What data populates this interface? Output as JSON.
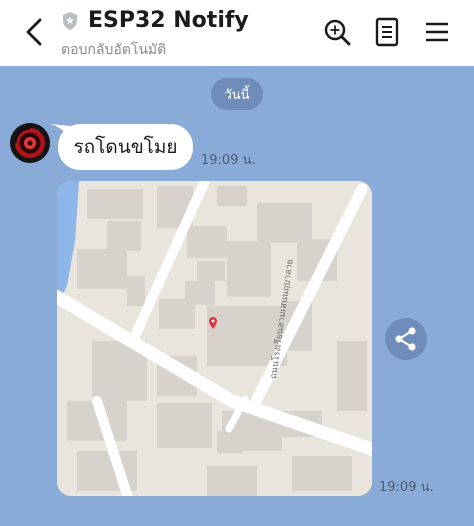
{
  "header": {
    "title": "ESP32 Notify",
    "subtitle": "ตอบกลับอัตโนมัติ",
    "icons": [
      "back-arrow-icon",
      "shield-star-icon",
      "search-icon",
      "notes-icon",
      "menu-icon"
    ]
  },
  "chat": {
    "date_label": "วันนี้",
    "messages": [
      {
        "type": "text",
        "text": "รถโดนขโมย",
        "time": "19:09 น."
      },
      {
        "type": "map",
        "street_label": "ถนนโรงเรียนสามเสนนฤบาลาย",
        "time": "19:09 น."
      }
    ]
  },
  "colors": {
    "chat_background": "#8aaad8",
    "date_pill": "#6f8cba",
    "share_button": "#6f8cba",
    "map_pin": "#d9363e"
  }
}
